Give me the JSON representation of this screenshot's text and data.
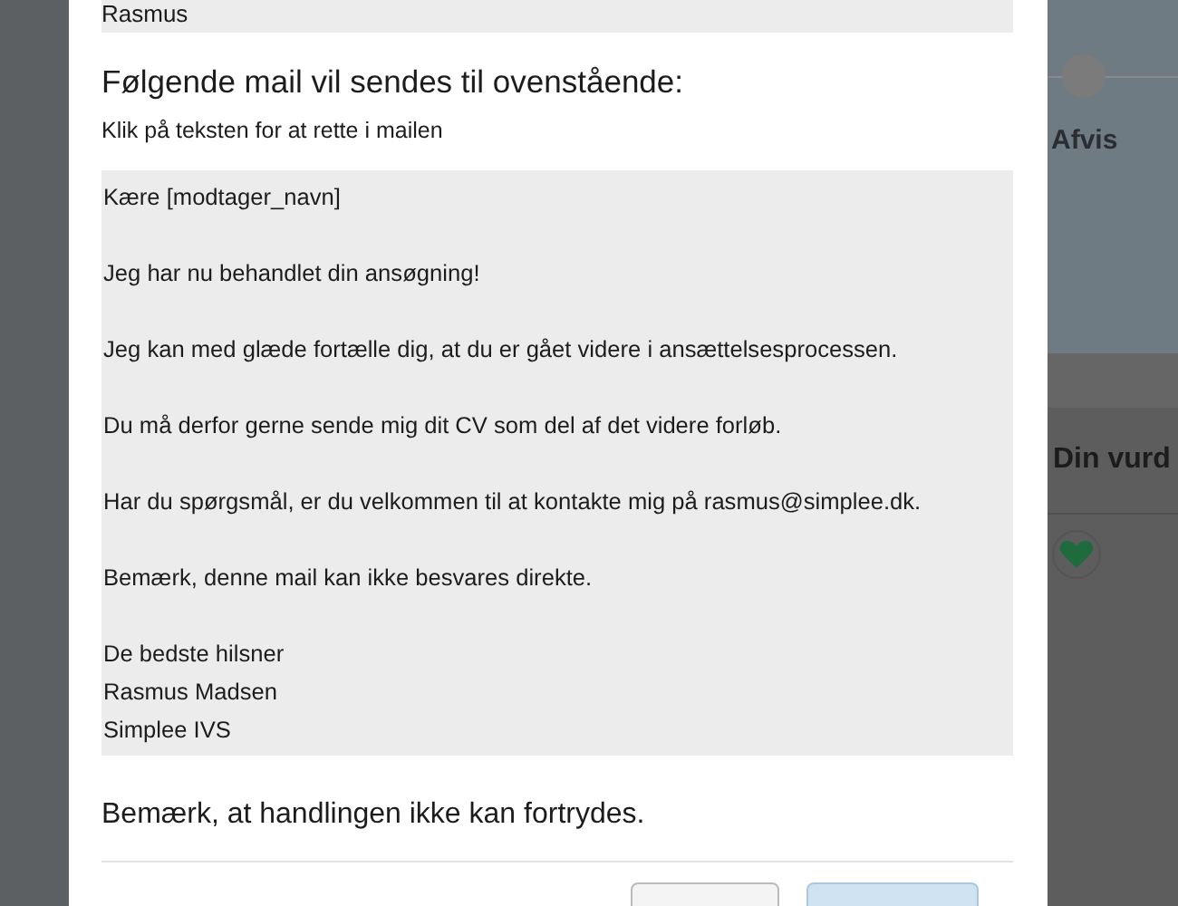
{
  "recipient": "Rasmus",
  "heading": "Følgende mail vil sendes til ovenstående:",
  "hint": "Klik på teksten for at rette i mailen",
  "email": {
    "paragraphs": [
      "Kære [modtager_navn]",
      "Jeg har nu behandlet din ansøgning!",
      "Jeg kan med glæde fortælle dig, at du er gået videre i ansættelsesprocessen.",
      "Du må derfor gerne sende mig dit CV som del af det videre forløb.",
      "Har du spørgsmål, er du velkommen til at kontakte mig på rasmus@simplee.dk.",
      "Bemærk, denne mail kan ikke besvares direkte."
    ],
    "signature": [
      "De bedste hilsner",
      "Rasmus Madsen",
      "Simplee IVS"
    ]
  },
  "warning": "Bemærk, at handlingen ikke kan fortrydes.",
  "buttons": [
    {
      "kind": "secondary"
    },
    {
      "kind": "primary"
    }
  ],
  "background": {
    "step_label": "Afvis",
    "column_heading": "Din vurd"
  }
}
